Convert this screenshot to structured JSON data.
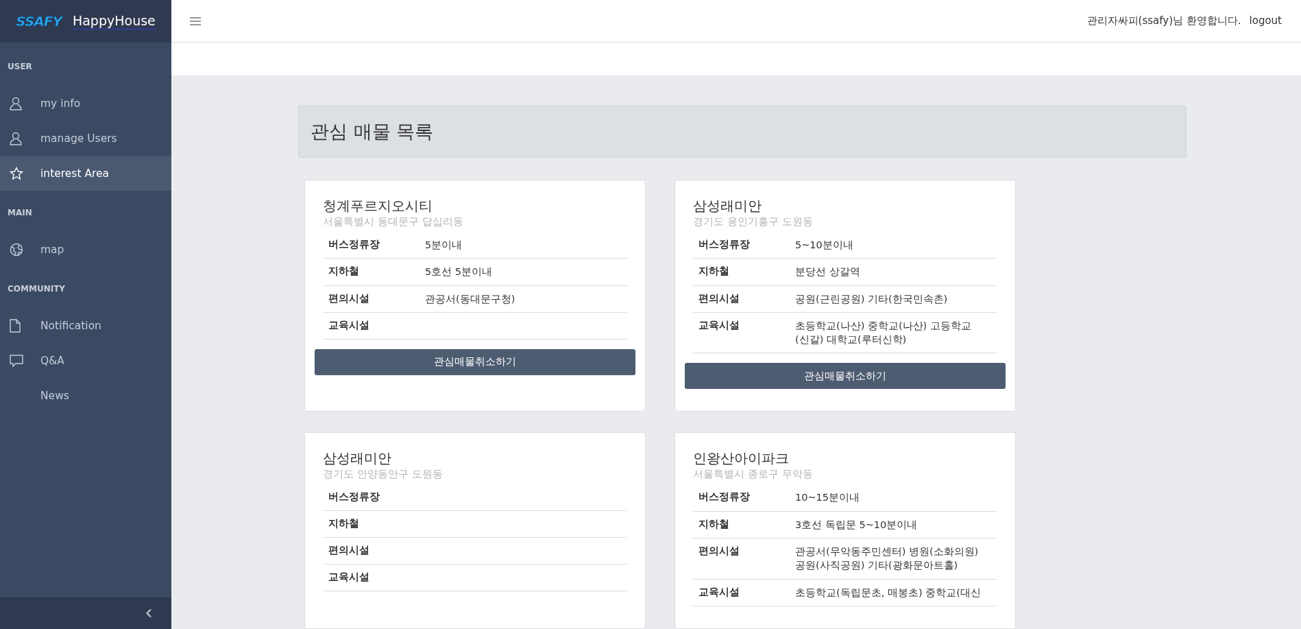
{
  "brand": {
    "logo": "SSAFY",
    "name": "HappyHouse"
  },
  "sidebar": {
    "sections": [
      {
        "heading": "USER",
        "items": [
          {
            "label": "my info",
            "kind": "user",
            "selected": false
          },
          {
            "label": "manage Users",
            "kind": "user",
            "selected": false
          },
          {
            "label": "interest Area",
            "kind": "star",
            "selected": true
          }
        ]
      },
      {
        "heading": "MAIN",
        "items": [
          {
            "label": "map",
            "kind": "globe",
            "selected": false
          }
        ]
      },
      {
        "heading": "COMMUNITY",
        "items": [
          {
            "label": "Notification",
            "kind": "file",
            "selected": false
          },
          {
            "label": "Q&A",
            "kind": "chat",
            "selected": false
          },
          {
            "label": "News",
            "kind": "plain",
            "selected": false
          }
        ]
      }
    ]
  },
  "header": {
    "greeting": "관리자싸피(ssafy)님 환영합니다.",
    "logout": "logout"
  },
  "page_title": "관심 매물 목록",
  "cards": [
    {
      "name": "청계푸르지오시티",
      "address": "서울특별시 동대문구 답십리동",
      "rows": [
        {
          "label": "버스정류장",
          "value": "5분이내"
        },
        {
          "label": "지하철",
          "value": "5호선 5분이내"
        },
        {
          "label": "편의시설",
          "value": "관공서(동대문구청)"
        },
        {
          "label": "교육시설"
        }
      ],
      "button": "관심매물취소하기"
    },
    {
      "name": "삼성래미안",
      "address": "경기도 용인기흥구 도원동",
      "rows": [
        {
          "label": "버스정류장",
          "value": "5~10분이내"
        },
        {
          "label": "지하철",
          "value": "분당선 상갈역"
        },
        {
          "label": "편의시설",
          "value": "공원(근린공원) 기타(한국민속촌)"
        },
        {
          "label": "교육시설",
          "value": "초등학교(나산) 중학교(나산) 고등학교(신갈) 대학교(루터신학)"
        }
      ],
      "button": "관심매물취소하기"
    },
    {
      "name": "삼성래미안",
      "address": "경기도 안양동안구 도원동",
      "rows": [
        {
          "label": "버스정류장"
        },
        {
          "label": "지하철"
        },
        {
          "label": "편의시설"
        },
        {
          "label": "교육시설"
        }
      ]
    },
    {
      "name": "인왕산아이파크",
      "address": "서울특별시 종로구 무악동",
      "rows": [
        {
          "label": "버스정류장",
          "value": "10~15분이내"
        },
        {
          "label": "지하철",
          "value": "3호선 독립문 5~10분이내"
        },
        {
          "label": "편의시설",
          "value": "관공서(무악동주민센터) 병원(소화의원) 공원(사직공원) 기타(광화문아트홀)"
        },
        {
          "label": "교육시설",
          "value": "초등학교(독립문초, 매봉초) 중학교(대신"
        }
      ]
    }
  ]
}
